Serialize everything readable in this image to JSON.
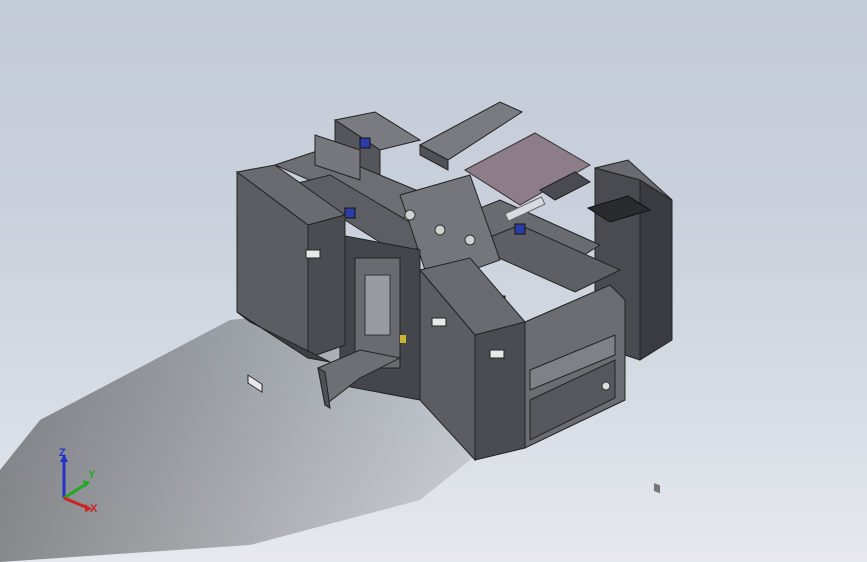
{
  "viewport": {
    "background_top": "#c4ccd8",
    "background_bottom": "#e6e9ee"
  },
  "model": {
    "description_icon": "assembly-machine-icon",
    "body_color": "#5f6066",
    "dark_panel_color": "#3a3b40",
    "plate_color": "#8c7d88",
    "accent_blue": "#2b3ea8"
  },
  "triad": {
    "z_label": "Z",
    "y_label": "Y",
    "x_label": "X",
    "z_color": "#2233cc",
    "y_color": "#22aa22",
    "x_color": "#cc2222"
  }
}
